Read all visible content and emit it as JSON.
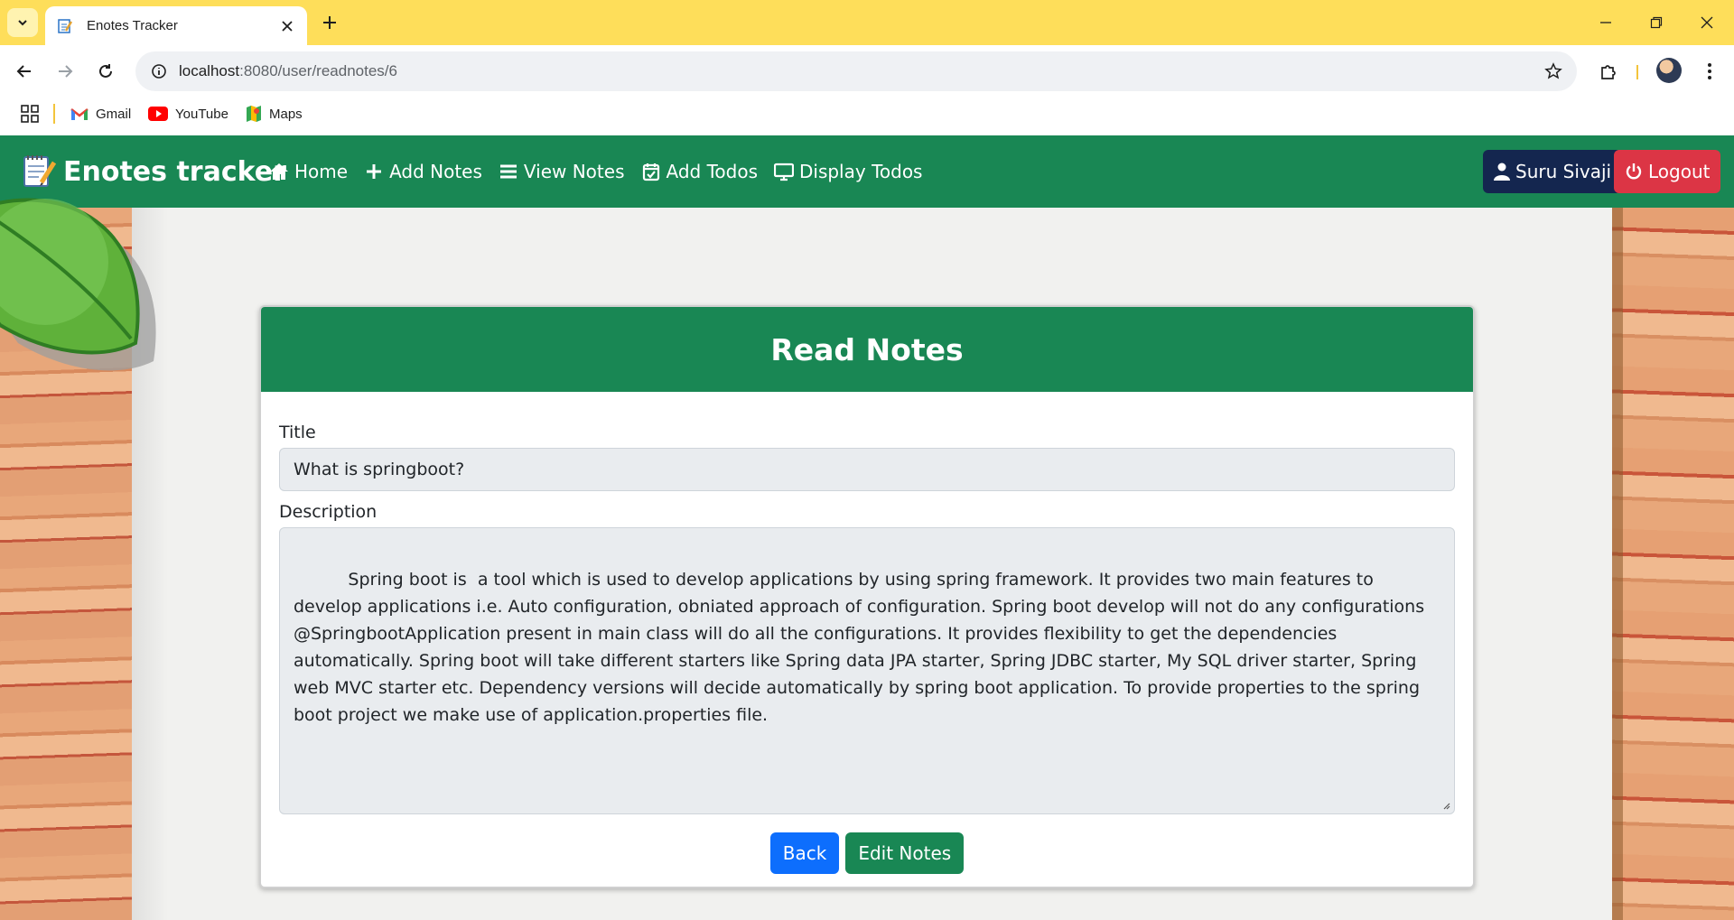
{
  "browser": {
    "tab_title": "Enotes Tracker",
    "url_host": "localhost",
    "url_rest": ":8080/user/readnotes/6",
    "bookmarks": [
      {
        "label": "Gmail",
        "icon": "gmail-icon"
      },
      {
        "label": "YouTube",
        "icon": "youtube-icon"
      },
      {
        "label": "Maps",
        "icon": "maps-icon"
      }
    ]
  },
  "app": {
    "brand": "Enotes tracker",
    "nav": [
      {
        "label": "Home",
        "icon": "home-icon"
      },
      {
        "label": "Add Notes",
        "icon": "plus-icon"
      },
      {
        "label": "View Notes",
        "icon": "list-icon"
      },
      {
        "label": "Add Todos",
        "icon": "calendar-check-icon"
      },
      {
        "label": "Display Todos",
        "icon": "monitor-icon"
      }
    ],
    "user_name": "Suru Sivaji",
    "logout_label": "Logout",
    "colors": {
      "primary": "#198754",
      "user": "#14264f",
      "danger": "#dc3545",
      "back": "#0d6efd"
    }
  },
  "card": {
    "header": "Read Notes",
    "title_label": "Title",
    "title_value": "What is springboot?",
    "description_label": "Description",
    "description_value": "Spring boot is  a tool which is used to develop applications by using spring framework. It provides two main features to develop applications i.e. Auto configuration, obniated approach of configuration. Spring boot develop will not do any configurations @SpringbootApplication present in main class will do all the configurations. It provides flexibility to get the dependencies automatically. Spring boot will take different starters like Spring data JPA starter, Spring JDBC starter, My SQL driver starter, Spring web MVC starter etc. Dependency versions will decide automatically by spring boot application. To provide properties to the spring boot project we make use of application.properties file.",
    "back_label": "Back",
    "edit_label": "Edit Notes"
  }
}
